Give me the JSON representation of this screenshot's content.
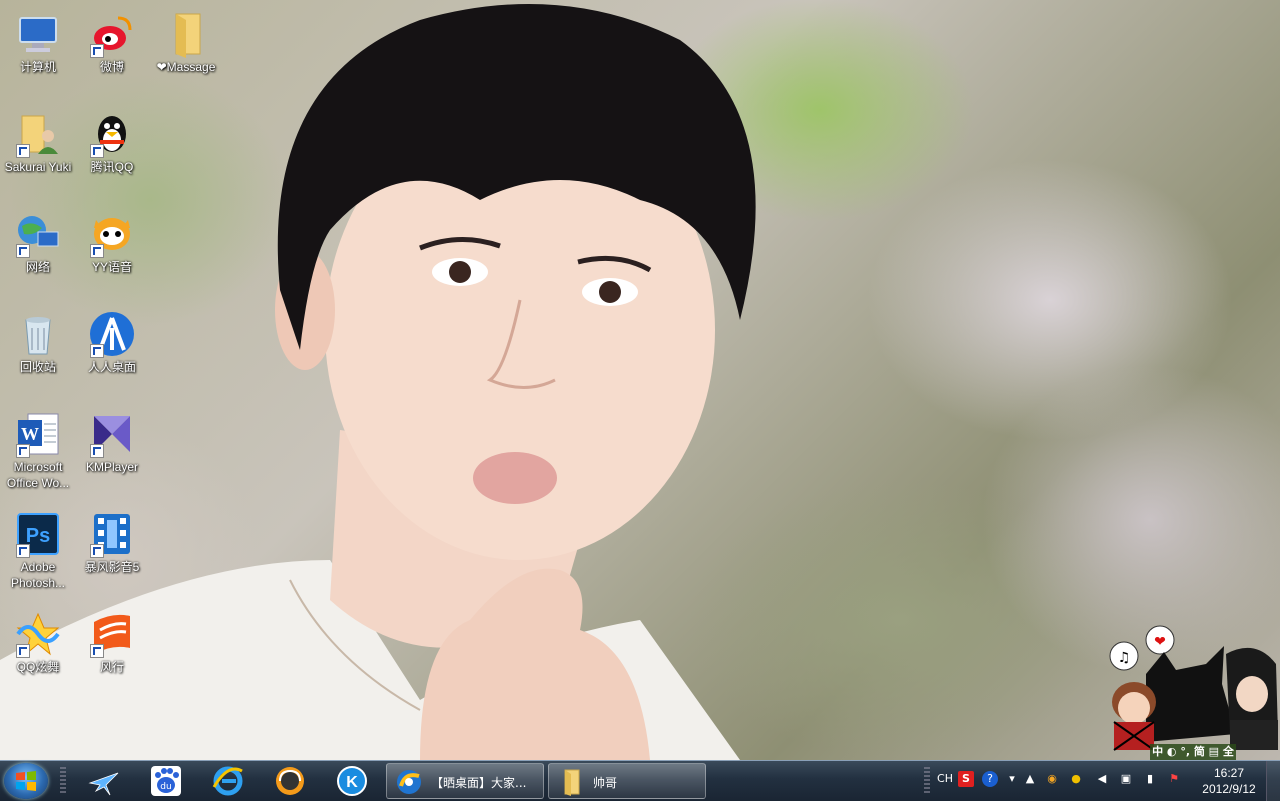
{
  "desktop": {
    "icons": [
      {
        "label": "计算机",
        "icon": "computer-icon"
      },
      {
        "label": "微博",
        "icon": "weibo-icon"
      },
      {
        "label": "❤Massage",
        "icon": "folder-icon"
      },
      {
        "label": "Sakurai Yuki",
        "icon": "user-folder-icon"
      },
      {
        "label": "腾讯QQ",
        "icon": "qq-penguin-icon"
      },
      {
        "label": "网络",
        "icon": "network-icon"
      },
      {
        "label": "YY语音",
        "icon": "yy-voice-icon"
      },
      {
        "label": "回收站",
        "icon": "recycle-bin-icon"
      },
      {
        "label": "人人桌面",
        "icon": "renren-icon"
      },
      {
        "label": "Microsoft Office Wo...",
        "icon": "word-icon"
      },
      {
        "label": "KMPlayer",
        "icon": "kmplayer-icon"
      },
      {
        "label": "Adobe Photosh...",
        "icon": "photoshop-icon"
      },
      {
        "label": "暴风影音5",
        "icon": "baofeng-icon"
      },
      {
        "label": "QQ炫舞",
        "icon": "qq-dance-icon"
      },
      {
        "label": "风行",
        "icon": "funshion-icon"
      }
    ]
  },
  "taskbar": {
    "quick_launch": [
      "airplane-icon",
      "baidu-icon",
      "internet-explorer-icon",
      "music-player-icon",
      "kugou-icon"
    ],
    "tasks": [
      {
        "label": "【晒桌面】大家...",
        "icon": "browser-icon"
      },
      {
        "label": "帅哥",
        "icon": "folder-icon"
      }
    ],
    "tray": {
      "language": "CH",
      "ime_status": "中 ◐ °, 简 ▤ 全",
      "icons": [
        "sogou-icon",
        "help-icon",
        "arrow-icon",
        "expand-icon",
        "cat-icon",
        "qq-icon",
        "volume-icon",
        "network-icon",
        "battery-icon",
        "flag-icon"
      ]
    },
    "clock": {
      "time": "16:27",
      "date": "2012/9/12"
    }
  },
  "colors": {
    "taskbar": "#223040",
    "label_text": "#ffffff"
  }
}
